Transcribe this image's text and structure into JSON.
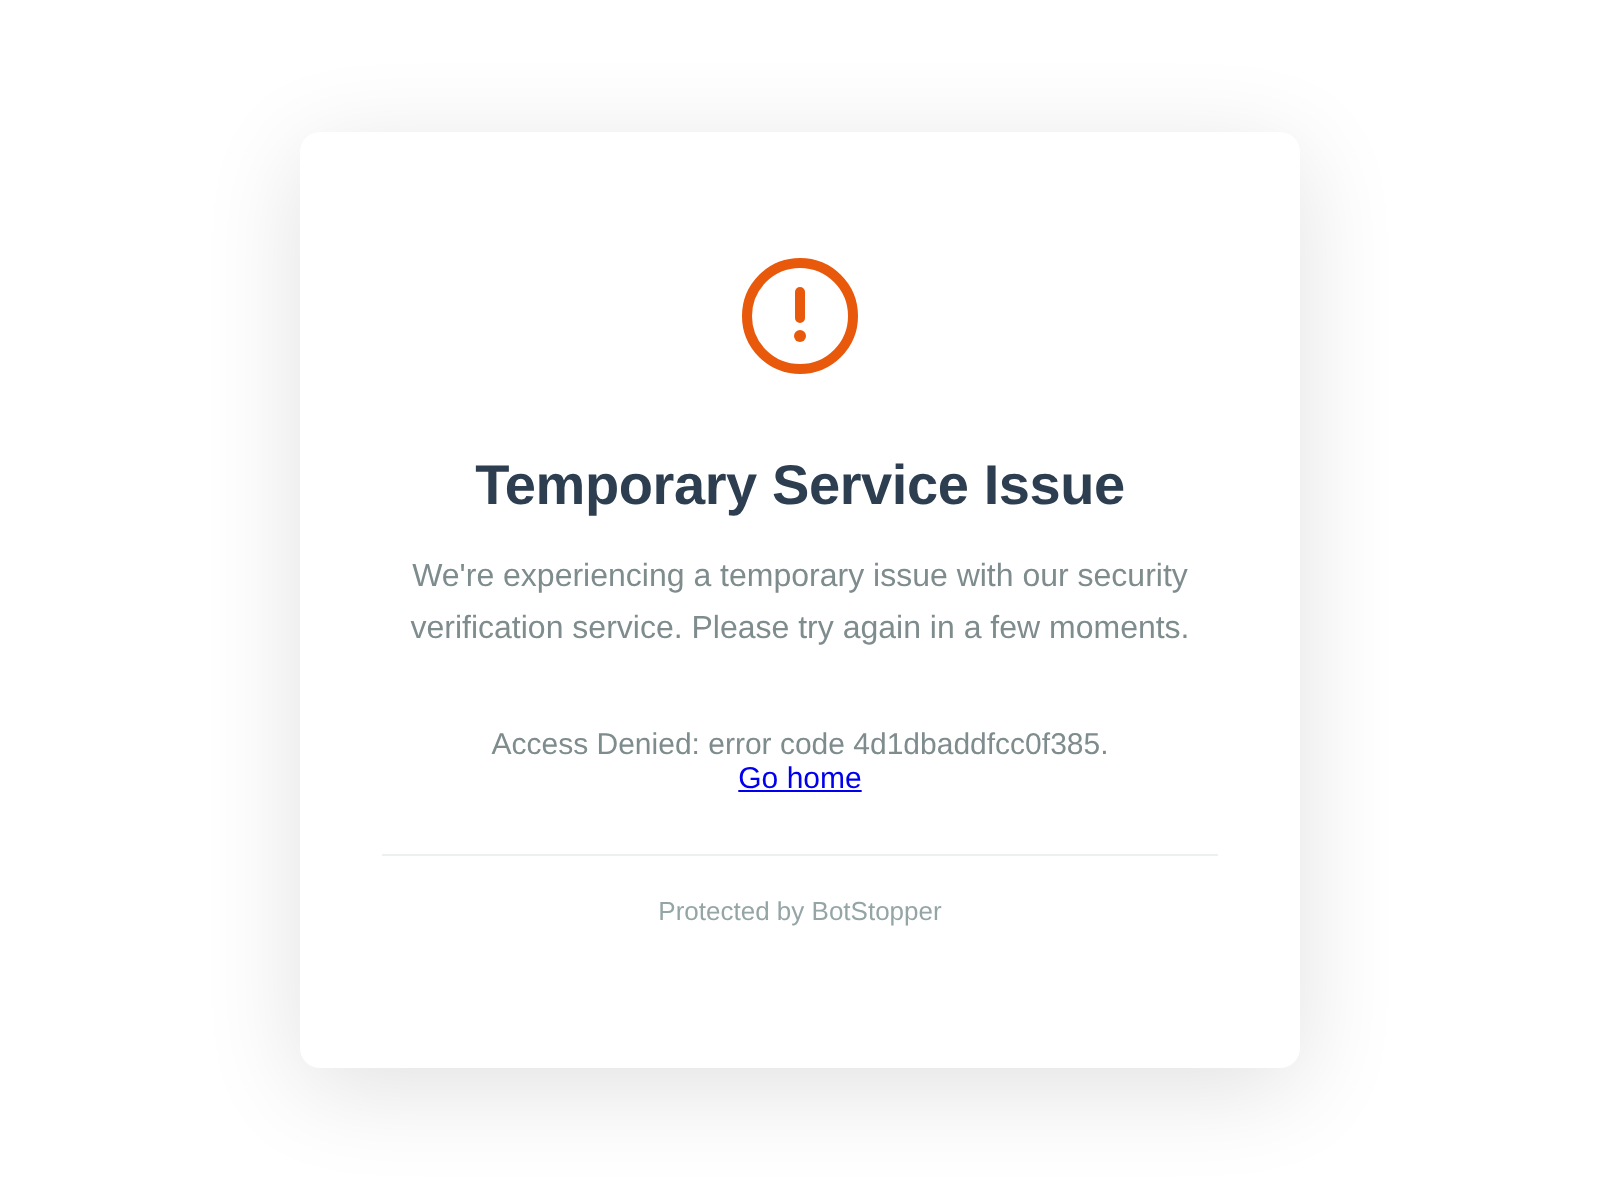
{
  "title": "Temporary Service Issue",
  "message": "We're experiencing a temporary issue with our security verification service. Please try again in a few moments.",
  "error": "Access Denied: error code 4d1dbaddfcc0f385.",
  "link": "Go home",
  "footer": "Protected by BotStopper"
}
